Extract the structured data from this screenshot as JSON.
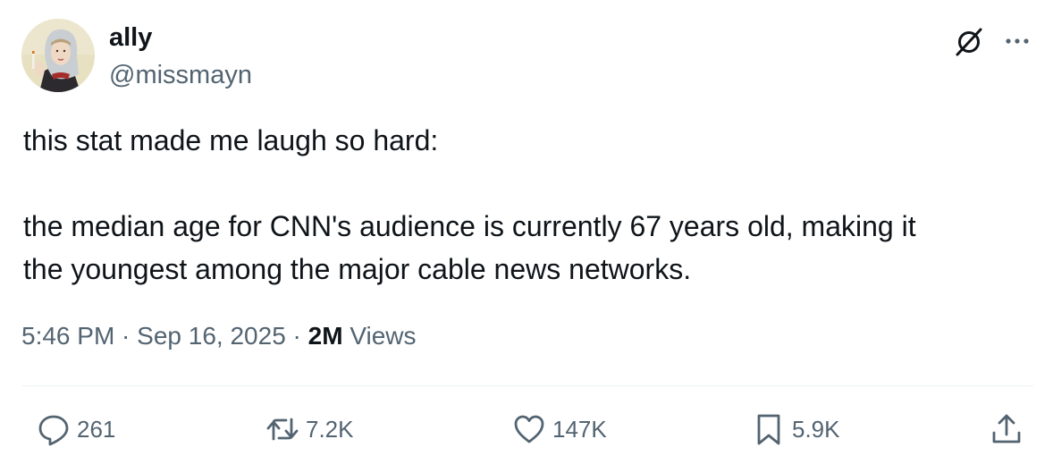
{
  "author": {
    "display_name": "ally",
    "handle": "@missmayn"
  },
  "tweet": {
    "paragraphs": [
      "this stat made me laugh so hard:",
      "the median age for CNN's audience is currently 67 years old, making it\nthe youngest among the major cable news networks."
    ]
  },
  "meta": {
    "time": "5:46 PM",
    "separator": " · ",
    "date": "Sep 16, 2025",
    "views_count": "2M",
    "views_label": " Views"
  },
  "actions": {
    "replies": "261",
    "retweets": "7.2K",
    "likes": "147K",
    "bookmarks": "5.9K"
  },
  "icons": {
    "header": [
      "grok-icon",
      "more-icon"
    ],
    "actions": [
      "reply-icon",
      "retweet-icon",
      "like-icon",
      "bookmark-icon",
      "share-icon"
    ]
  },
  "colors": {
    "text_primary": "#0f1419",
    "text_secondary": "#536471",
    "divider": "#eff3f4"
  }
}
